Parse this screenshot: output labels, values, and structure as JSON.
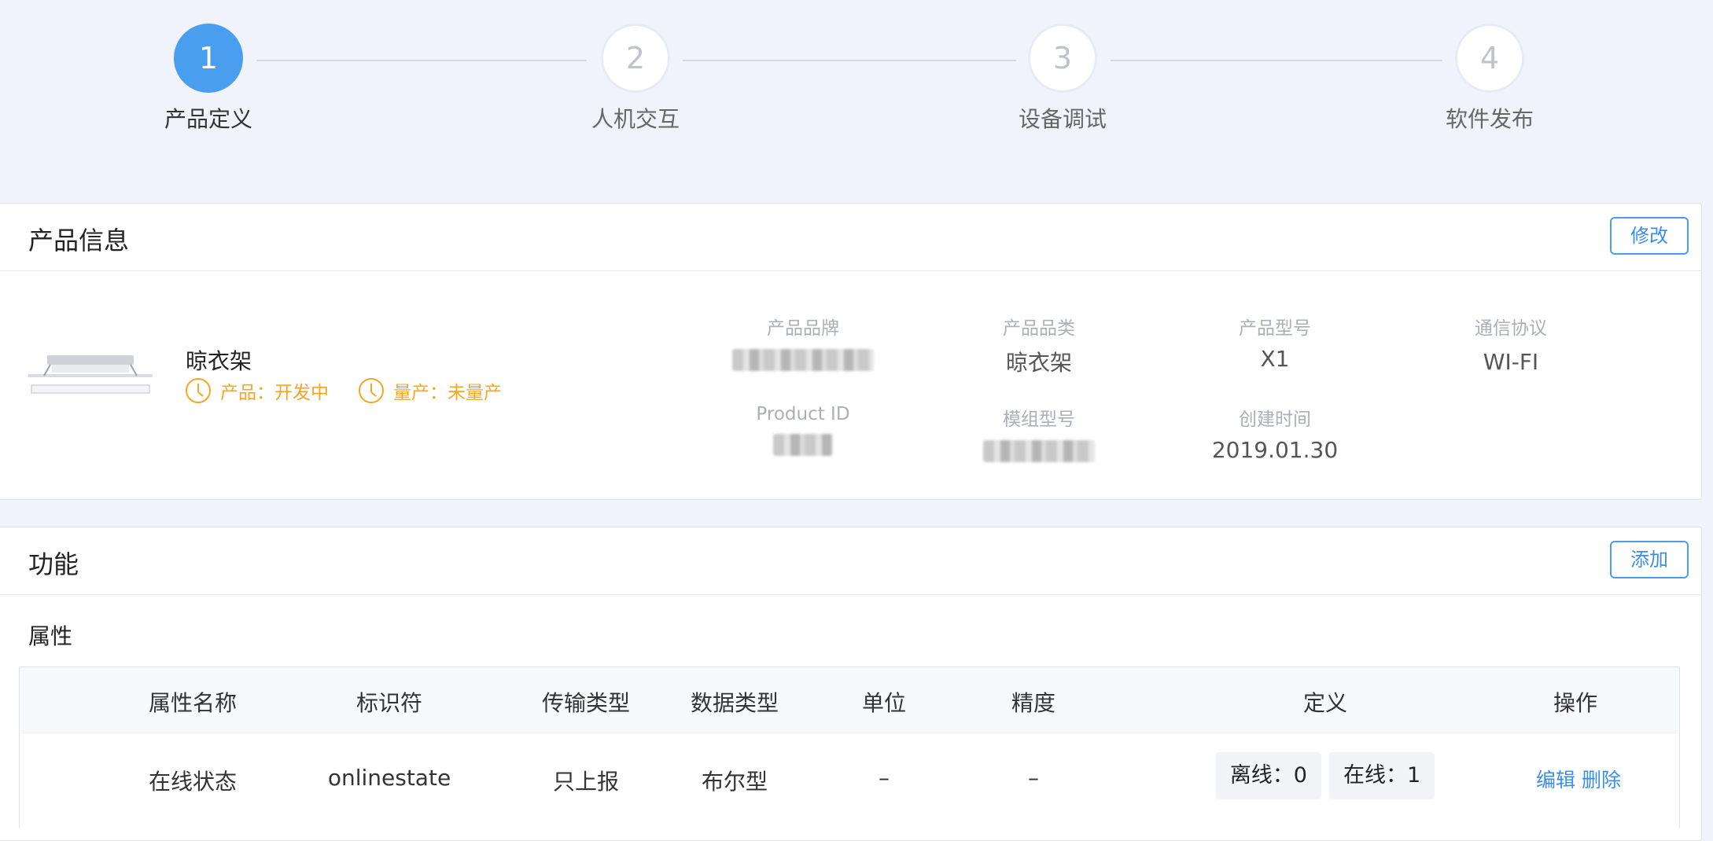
{
  "steps": [
    {
      "num": "1",
      "label": "产品定义",
      "active": true
    },
    {
      "num": "2",
      "label": "人机交互",
      "active": false
    },
    {
      "num": "3",
      "label": "设备调试",
      "active": false
    },
    {
      "num": "4",
      "label": "软件发布",
      "active": false
    }
  ],
  "product_card": {
    "title": "产品信息",
    "edit_label": "修改",
    "name": "晾衣架",
    "status_product": "产品：开发中",
    "status_mass": "量产：未量产",
    "fields": {
      "brand_label": "产品品牌",
      "category_label": "产品品类",
      "category_value": "晾衣架",
      "model_label": "产品型号",
      "model_value": "X1",
      "protocol_label": "通信协议",
      "protocol_value": "WI-FI",
      "pid_label": "Product ID",
      "module_label": "模组型号",
      "created_label": "创建时间",
      "created_value": "2019.01.30"
    }
  },
  "function_card": {
    "title": "功能",
    "add_label": "添加",
    "section": "属性",
    "columns": [
      "属性名称",
      "标识符",
      "传输类型",
      "数据类型",
      "单位",
      "精度",
      "定义",
      "操作"
    ],
    "rows": [
      {
        "name": "在线状态",
        "identifier": "onlinestate",
        "transfer": "只上报",
        "datatype": "布尔型",
        "unit": "–",
        "precision": "–",
        "def_off": "离线：0",
        "def_on": "在线：1",
        "edit": "编辑",
        "delete": "删除"
      }
    ]
  }
}
